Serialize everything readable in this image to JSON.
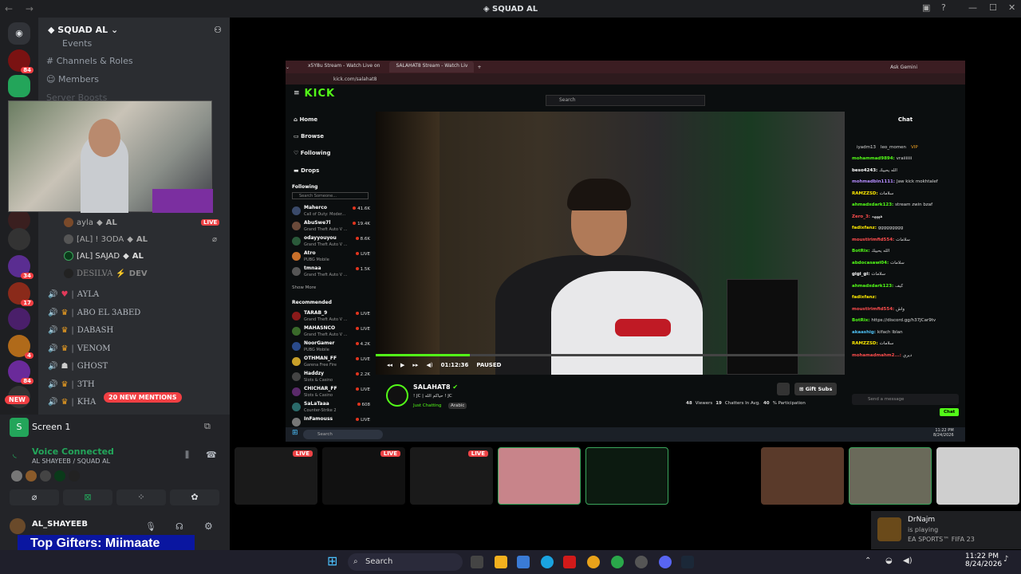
{
  "window": {
    "title": "SQUAD AL"
  },
  "server": {
    "name": "SQUAD AL",
    "badges": [
      "84",
      "48",
      "34",
      "17",
      "4",
      "84"
    ],
    "new_label": "NEW"
  },
  "sidebar": {
    "items": [
      "Events",
      "Channels & Roles",
      "Members",
      "Server Boosts"
    ],
    "voice_users": [
      {
        "name": "ayla",
        "tag": "AL",
        "live": "LIVE"
      },
      {
        "name": "[AL] ! 3ODA",
        "tag": "AL"
      },
      {
        "name": "[AL] SAJAD",
        "tag": "AL"
      },
      {
        "name": "DESILVA",
        "tag": "DEV"
      }
    ],
    "channels": [
      "AYLA",
      "ABO EL 3ABED",
      "DABASH",
      "VENOM",
      "GHOST",
      "3TH",
      "KHA"
    ],
    "mentions": "20 NEW MENTIONS"
  },
  "voice": {
    "screen_label": "Screen 1",
    "status": "Voice Connected",
    "location": "AL SHAYEEB / SQUAD AL",
    "user": "AL_SHAYEEB"
  },
  "gifters": "Top Gifters: Miimaate",
  "browser": {
    "tabs": [
      "x5Y8u Stream - Watch Live on",
      "SALAHAT8 Stream - Watch Liv"
    ],
    "url": "kick.com/salahat8",
    "ask": "Ask Gemini"
  },
  "kick": {
    "logo": "KICK",
    "search": "Search",
    "nav": [
      "Home",
      "Browse",
      "Following",
      "Drops"
    ],
    "following_label": "Following",
    "search_someone": "Search Someone...",
    "following": [
      {
        "name": "Maherco",
        "game": "Call of Duty: Moder...",
        "viewers": "41.6K"
      },
      {
        "name": "AbuSwe7l",
        "game": "Grand Theft Auto V ...",
        "viewers": "19.4K"
      },
      {
        "name": "odayyouyou",
        "game": "Grand Theft Auto V ...",
        "viewers": "8.6K"
      },
      {
        "name": "Atro",
        "game": "PUBG Mobile",
        "viewers": "LIVE"
      },
      {
        "name": "tmnaa",
        "game": "Grand Theft Auto V ...",
        "viewers": "1.5K"
      }
    ],
    "show_more": "Show More",
    "recommended_label": "Recommended",
    "recommended": [
      {
        "name": "TARAB_9",
        "game": "Grand Theft Auto V ...",
        "viewers": "LIVE"
      },
      {
        "name": "MAHASNCO",
        "game": "Grand Theft Auto V ...",
        "viewers": "LIVE"
      },
      {
        "name": "NoorGamer",
        "game": "PUBG Mobile",
        "viewers": "4.2K"
      },
      {
        "name": "OTHMAN_FF",
        "game": "Garena Free Fire",
        "viewers": "LIVE"
      },
      {
        "name": "Haddzy",
        "game": "Slots & Casino",
        "viewers": "2.2K"
      },
      {
        "name": "CHICHAR_FF",
        "game": "Slots & Casino",
        "viewers": "LIVE"
      },
      {
        "name": "SaLaTaaa",
        "game": "Counter-Strike 2",
        "viewers": "608"
      },
      {
        "name": "InFamouss",
        "game": "",
        "viewers": "LIVE"
      }
    ],
    "player": {
      "time": "01:12:36",
      "state": "PAUSED"
    },
    "streamer": {
      "name": "SALAHAT8",
      "title": "! JC | حياكم الله ! JC",
      "category": "Just Chatting",
      "language": "Arabic",
      "viewers": "48",
      "viewers_label": "Viewers",
      "chatters": "19",
      "chatters_label": "Chatters In Avg.",
      "participation": "40",
      "participation_label": "% Participation",
      "gift_subs": "Gift Subs"
    },
    "chat": {
      "title": "Chat",
      "top": [
        "iyadm13",
        "leo_momen",
        "VIP"
      ],
      "messages": [
        {
          "user": "mohammad9894:",
          "text": "vraiiiiiii",
          "color": "#53fc18"
        },
        {
          "user": "beso4243:",
          "text": "الله يحييك",
          "color": "#ffffff"
        },
        {
          "user": "mohmadbin1111:",
          "text": "Jaw kick mokhtalef",
          "color": "#b48cff"
        },
        {
          "user": "RAMZZSD:",
          "text": "سلامات",
          "color": "#ffea00"
        },
        {
          "user": "ahmadxdark123:",
          "text": "stream zwin bzaf",
          "color": "#53fc18"
        },
        {
          "user": "Zero_3:",
          "text": "ههههه",
          "color": "#ff4d4d"
        },
        {
          "user": "fadixfanz:",
          "text": "ggggggggg",
          "color": "#ffea00"
        },
        {
          "user": "moustirimfid554:",
          "text": "سلامات",
          "color": "#ff4d4d"
        },
        {
          "user": "BotRix:",
          "text": "الله يحييك",
          "color": "#53fc18"
        },
        {
          "user": "abdocasawi04:",
          "text": "سلامات",
          "color": "#53fc18"
        },
        {
          "user": "gigi_gi:",
          "text": "سلامات",
          "color": "#ffffff"
        },
        {
          "user": "ahmadxdark123:",
          "text": "كيف",
          "color": "#53fc18"
        },
        {
          "user": "fadixfanz:",
          "text": "",
          "color": "#ffea00"
        },
        {
          "user": "moustirimfid554:",
          "text": "واش",
          "color": "#ff4d4d"
        },
        {
          "user": "BotRix:",
          "text": "https://discord.gg/h37JCar9tv",
          "color": "#53fc18"
        },
        {
          "user": "akaashig:",
          "text": "kifach lblan",
          "color": "#4fc3f7"
        },
        {
          "user": "RAMZZSD:",
          "text": "سلامات",
          "color": "#ffea00"
        },
        {
          "user": "mohamadmahm2...:",
          "text": "ديري",
          "color": "#ff4d4d"
        }
      ],
      "placeholder": "Send a message",
      "send": "Chat"
    },
    "taskbar": {
      "search": "Search",
      "time": "11:22 PM",
      "date": "8/24/2026"
    }
  },
  "thumbs": [
    {
      "live": "LIVE"
    },
    {
      "live": "LIVE"
    },
    {
      "live": "LIVE"
    },
    {},
    {},
    {},
    {},
    {},
    {}
  ],
  "toast": {
    "name": "DrNajm",
    "status": "is playing",
    "game": "EA SPORTS™ FIFA 23"
  },
  "taskbar": {
    "search": "Search",
    "time": "11:22 PM",
    "date": "8/24/2026"
  }
}
